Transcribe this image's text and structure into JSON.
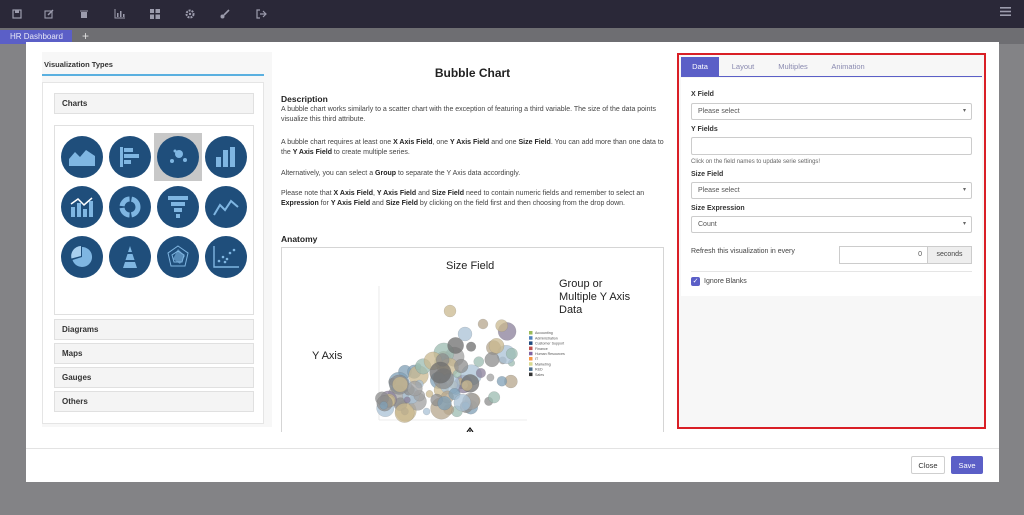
{
  "toolbar": {
    "icons": [
      "save-icon",
      "edit-icon",
      "trash-icon",
      "bar-chart-icon",
      "grid-icon",
      "gear-icon",
      "brush-icon",
      "sign-out-icon",
      "hamburger-menu-icon"
    ],
    "tab_label": "HR Dashboard",
    "add_tab": "+"
  },
  "left": {
    "title": "Visualization Types",
    "categories": {
      "charts": "Charts",
      "diagrams": "Diagrams",
      "maps": "Maps",
      "gauges": "Gauges",
      "others": "Others"
    },
    "chart_icons": [
      "area-chart-icon",
      "horizontal-bar-chart-icon",
      "bubble-chart-icon",
      "column-chart-icon",
      "combo-chart-icon",
      "donut-chart-icon",
      "funnel-chart-icon",
      "line-chart-icon",
      "pie-chart-icon",
      "pyramid-chart-icon",
      "radar-chart-icon",
      "scatter-chart-icon"
    ],
    "selected_icon": "bubble-chart-icon"
  },
  "middle": {
    "title": "Bubble Chart",
    "description_heading": "Description",
    "p1": "A bubble chart works similarly to a scatter chart with the exception of featuring a third variable. The size of the data points visualize this third attribute.",
    "p2_a": "A bubble chart requires at least one ",
    "p2_b": "X Axis Field",
    "p2_c": ", one ",
    "p2_d": "Y Axis Field",
    "p2_e": " and one ",
    "p2_f": "Size Field",
    "p2_g": ". You can add more than one data to the ",
    "p2_h": "Y Axis Field",
    "p2_i": " to create multiple series.",
    "p3_a": "Alternatively, you can select a ",
    "p3_b": "Group",
    "p3_c": " to separate the Y Axis data accordingly.",
    "p4_a": "Please note that ",
    "p4_b": "X Axis Field",
    "p4_c": ", ",
    "p4_d": "Y Axis Field",
    "p4_e": " and ",
    "p4_f": "Size Field",
    "p4_g": " need to contain numeric fields and remember to select an ",
    "p4_h": "Expression",
    "p4_i": " for ",
    "p4_j": "Y Axis Field",
    "p4_k": " and ",
    "p4_l": "Size Field",
    "p4_m": " by clicking on the field first and then choosing from the drop down.",
    "anatomy_heading": "Anatomy",
    "anatomy": {
      "size_field": "Size Field",
      "group": "Group or\nMultiple Y Axis\nData",
      "y_axis": "Y Axis",
      "legend": [
        "Accounting",
        "Administration",
        "Customer Support",
        "Finance",
        "Human Resources",
        "IT",
        "Marketing",
        "R&D",
        "Sales"
      ],
      "legend_colors": [
        "#9bbb59",
        "#4f81bd",
        "#1f497d",
        "#c0504d",
        "#8064a2",
        "#f79646",
        "#d9d98f",
        "#4b6e8c",
        "#333333"
      ]
    }
  },
  "right": {
    "tabs": [
      "Data",
      "Layout",
      "Multiples",
      "Animation"
    ],
    "active_tab": "Data",
    "x_field_label": "X Field",
    "x_field_value": "Please select",
    "y_fields_label": "Y Fields",
    "y_fields_value": "",
    "y_fields_hint": "Click on the field names to update serie settings!",
    "size_field_label": "Size Field",
    "size_field_value": "Please select",
    "size_expression_label": "Size Expression",
    "size_expression_value": "Count",
    "refresh_label": "Refresh this visualization in every",
    "refresh_value": "0",
    "refresh_unit": "seconds",
    "ignore_blanks_label": "Ignore Blanks",
    "ignore_blanks_checked": true
  },
  "footer": {
    "close": "Close",
    "save": "Save"
  }
}
